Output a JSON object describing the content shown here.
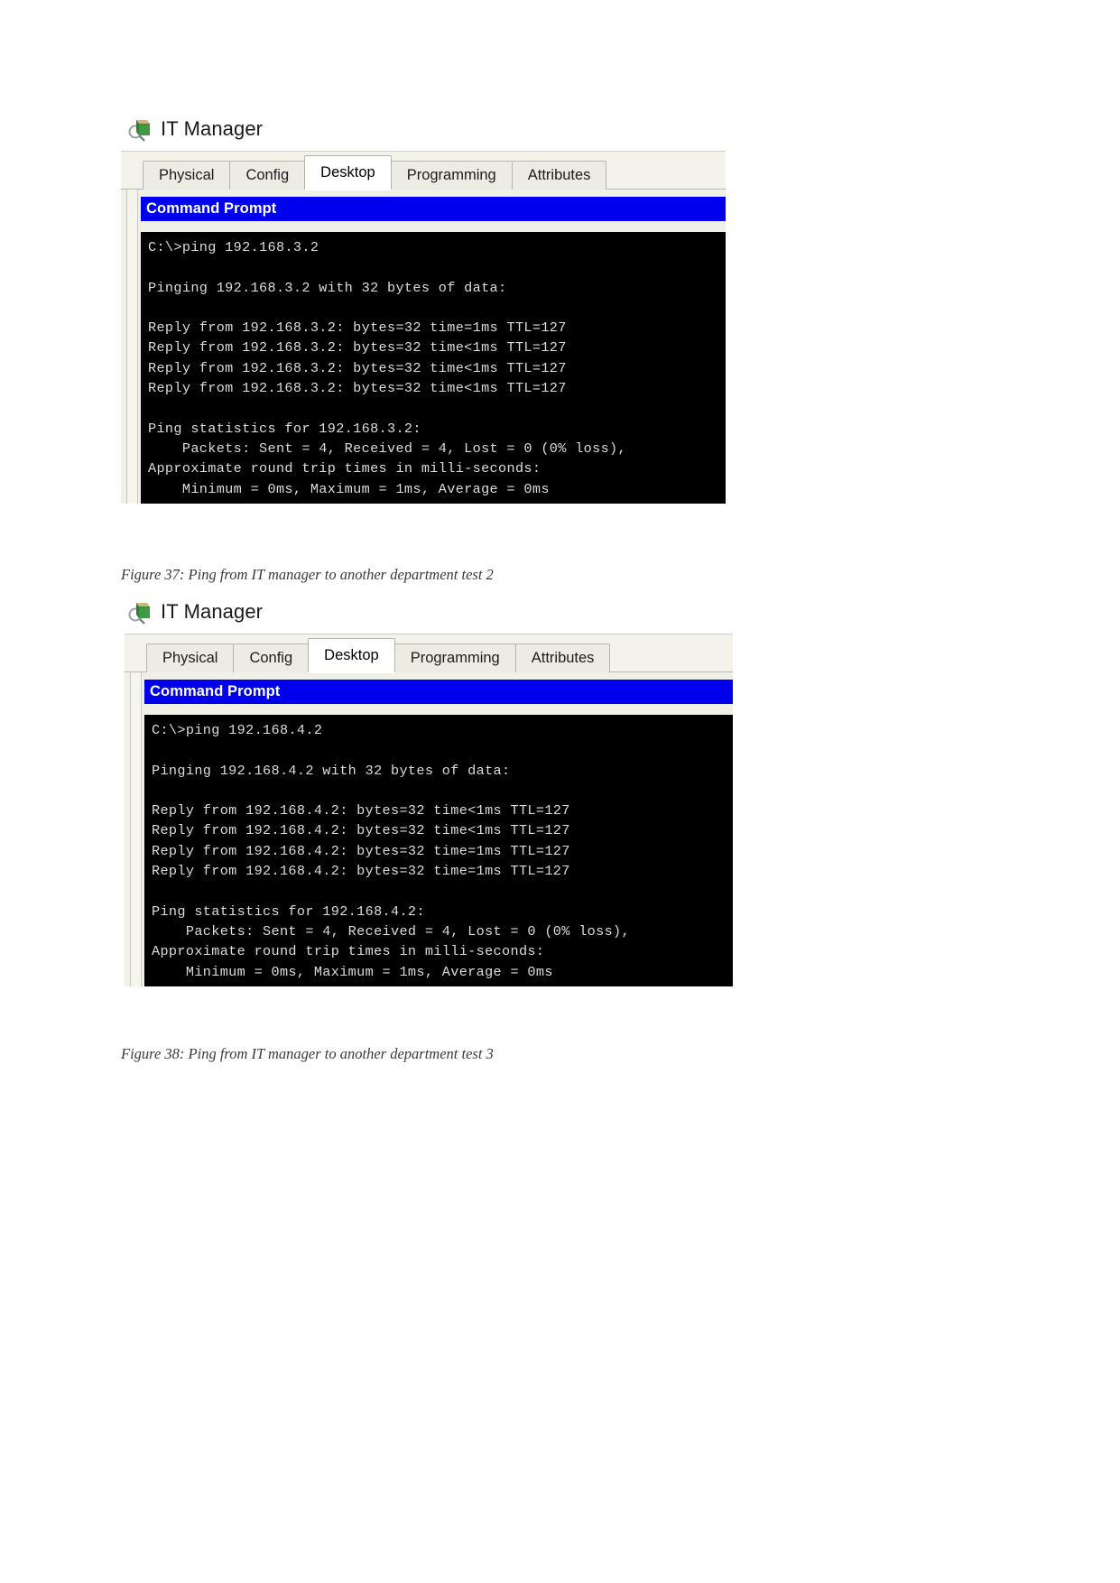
{
  "document": {
    "figures": [
      {
        "id": "figure-1",
        "window_title": "IT Manager",
        "icon": "pc-device-icon",
        "tabs": [
          {
            "label": "Physical",
            "active": false
          },
          {
            "label": "Config",
            "active": false
          },
          {
            "label": "Desktop",
            "active": true
          },
          {
            "label": "Programming",
            "active": false
          },
          {
            "label": "Attributes",
            "active": false
          }
        ],
        "app_title": "Command Prompt",
        "terminal_lines": [
          "C:\\>ping 192.168.3.2",
          "",
          "Pinging 192.168.3.2 with 32 bytes of data:",
          "",
          "Reply from 192.168.3.2: bytes=32 time=1ms TTL=127",
          "Reply from 192.168.3.2: bytes=32 time<1ms TTL=127",
          "Reply from 192.168.3.2: bytes=32 time<1ms TTL=127",
          "Reply from 192.168.3.2: bytes=32 time<1ms TTL=127",
          "",
          "Ping statistics for 192.168.3.2:",
          "    Packets: Sent = 4, Received = 4, Lost = 0 (0% loss),",
          "Approximate round trip times in milli-seconds:",
          "    Minimum = 0ms, Maximum = 1ms, Average = 0ms"
        ],
        "caption": "Figure 37: Ping from IT manager to another department test 2"
      },
      {
        "id": "figure-2",
        "window_title": "IT Manager",
        "icon": "pc-device-icon",
        "tabs": [
          {
            "label": "Physical",
            "active": false
          },
          {
            "label": "Config",
            "active": false
          },
          {
            "label": "Desktop",
            "active": true
          },
          {
            "label": "Programming",
            "active": false
          },
          {
            "label": "Attributes",
            "active": false
          }
        ],
        "app_title": "Command Prompt",
        "terminal_lines": [
          "C:\\>ping 192.168.4.2",
          "",
          "Pinging 192.168.4.2 with 32 bytes of data:",
          "",
          "Reply from 192.168.4.2: bytes=32 time<1ms TTL=127",
          "Reply from 192.168.4.2: bytes=32 time<1ms TTL=127",
          "Reply from 192.168.4.2: bytes=32 time=1ms TTL=127",
          "Reply from 192.168.4.2: bytes=32 time=1ms TTL=127",
          "",
          "Ping statistics for 192.168.4.2:",
          "    Packets: Sent = 4, Received = 4, Lost = 0 (0% loss),",
          "Approximate round trip times in milli-seconds:",
          "    Minimum = 0ms, Maximum = 1ms, Average = 0ms"
        ],
        "caption": "Figure 38: Ping from IT manager to another department test 3"
      }
    ]
  },
  "colors": {
    "cmd_titlebar_bg": "#0000ee",
    "cmd_titlebar_fg": "#ffffff",
    "terminal_bg": "#000000",
    "terminal_fg": "#dcdcdc",
    "window_chrome": "#f0f0e8",
    "tab_active_bg": "#ffffff"
  }
}
